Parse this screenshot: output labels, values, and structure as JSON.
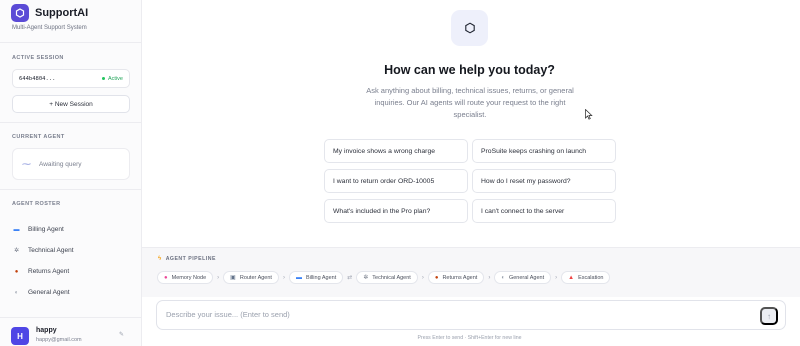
{
  "sidebar": {
    "brand_name": "SupportAI",
    "brand_sub": "Multi-Agent Support System",
    "active_session_label": "ACTIVE SESSION",
    "session_id": "644b4804...",
    "session_status": "Active",
    "new_session_label": "+ New Session",
    "current_agent_label": "CURRENT AGENT",
    "current_agent_text": "Awaiting query",
    "roster_label": "AGENT ROSTER",
    "roster": [
      {
        "label": "Billing Agent",
        "icon": "credit-card-icon",
        "glyph": "▬",
        "color": "#3b82f6"
      },
      {
        "label": "Technical Agent",
        "icon": "gear-icon",
        "glyph": "✲",
        "color": "#6b7280"
      },
      {
        "label": "Returns Agent",
        "icon": "package-icon",
        "glyph": "●",
        "color": "#c2410c"
      },
      {
        "label": "General Agent",
        "icon": "chat-icon",
        "glyph": "◐",
        "color": "#9ca3af"
      }
    ],
    "user_initial": "H",
    "user_name": "happy",
    "user_email": "happy@gmail.com"
  },
  "main": {
    "hero_title": "How can we help you today?",
    "hero_sub": "Ask anything about billing, technical issues, returns, or general inquiries. Our AI agents will route your request to the right specialist.",
    "suggestions": [
      "My invoice shows a wrong charge",
      "ProSuite keeps crashing on launch",
      "I want to return order ORD-10005",
      "How do I reset my password?",
      "What's included in the Pro plan?",
      "I can't connect to the server"
    ],
    "pipeline_label": "AGENT PIPELINE",
    "pipeline": [
      {
        "label": "Memory Node",
        "icon": "brain-icon",
        "glyph": "●",
        "color": "#ec4899"
      },
      {
        "label": "Router Agent",
        "icon": "router-icon",
        "glyph": "▣",
        "color": "#64748b"
      },
      {
        "label": "Billing Agent",
        "icon": "credit-card-icon",
        "glyph": "▬",
        "color": "#3b82f6"
      },
      {
        "label": "Technical Agent",
        "icon": "gear-icon",
        "glyph": "✲",
        "color": "#6b7280"
      },
      {
        "label": "Returns Agent",
        "icon": "package-icon",
        "glyph": "●",
        "color": "#c2410c"
      },
      {
        "label": "General Agent",
        "icon": "chat-icon",
        "glyph": "◐",
        "color": "#9ca3af"
      },
      {
        "label": "Escalation",
        "icon": "alert-icon",
        "glyph": "▲",
        "color": "#ef4444"
      }
    ],
    "pipeline_separators": [
      "›",
      "›",
      "⇄",
      "›",
      "›",
      "›"
    ],
    "composer_placeholder": "Describe your issue... (Enter to send)",
    "send_glyph": "↑",
    "hint": "Press Enter to send · Shift+Enter for new line"
  }
}
